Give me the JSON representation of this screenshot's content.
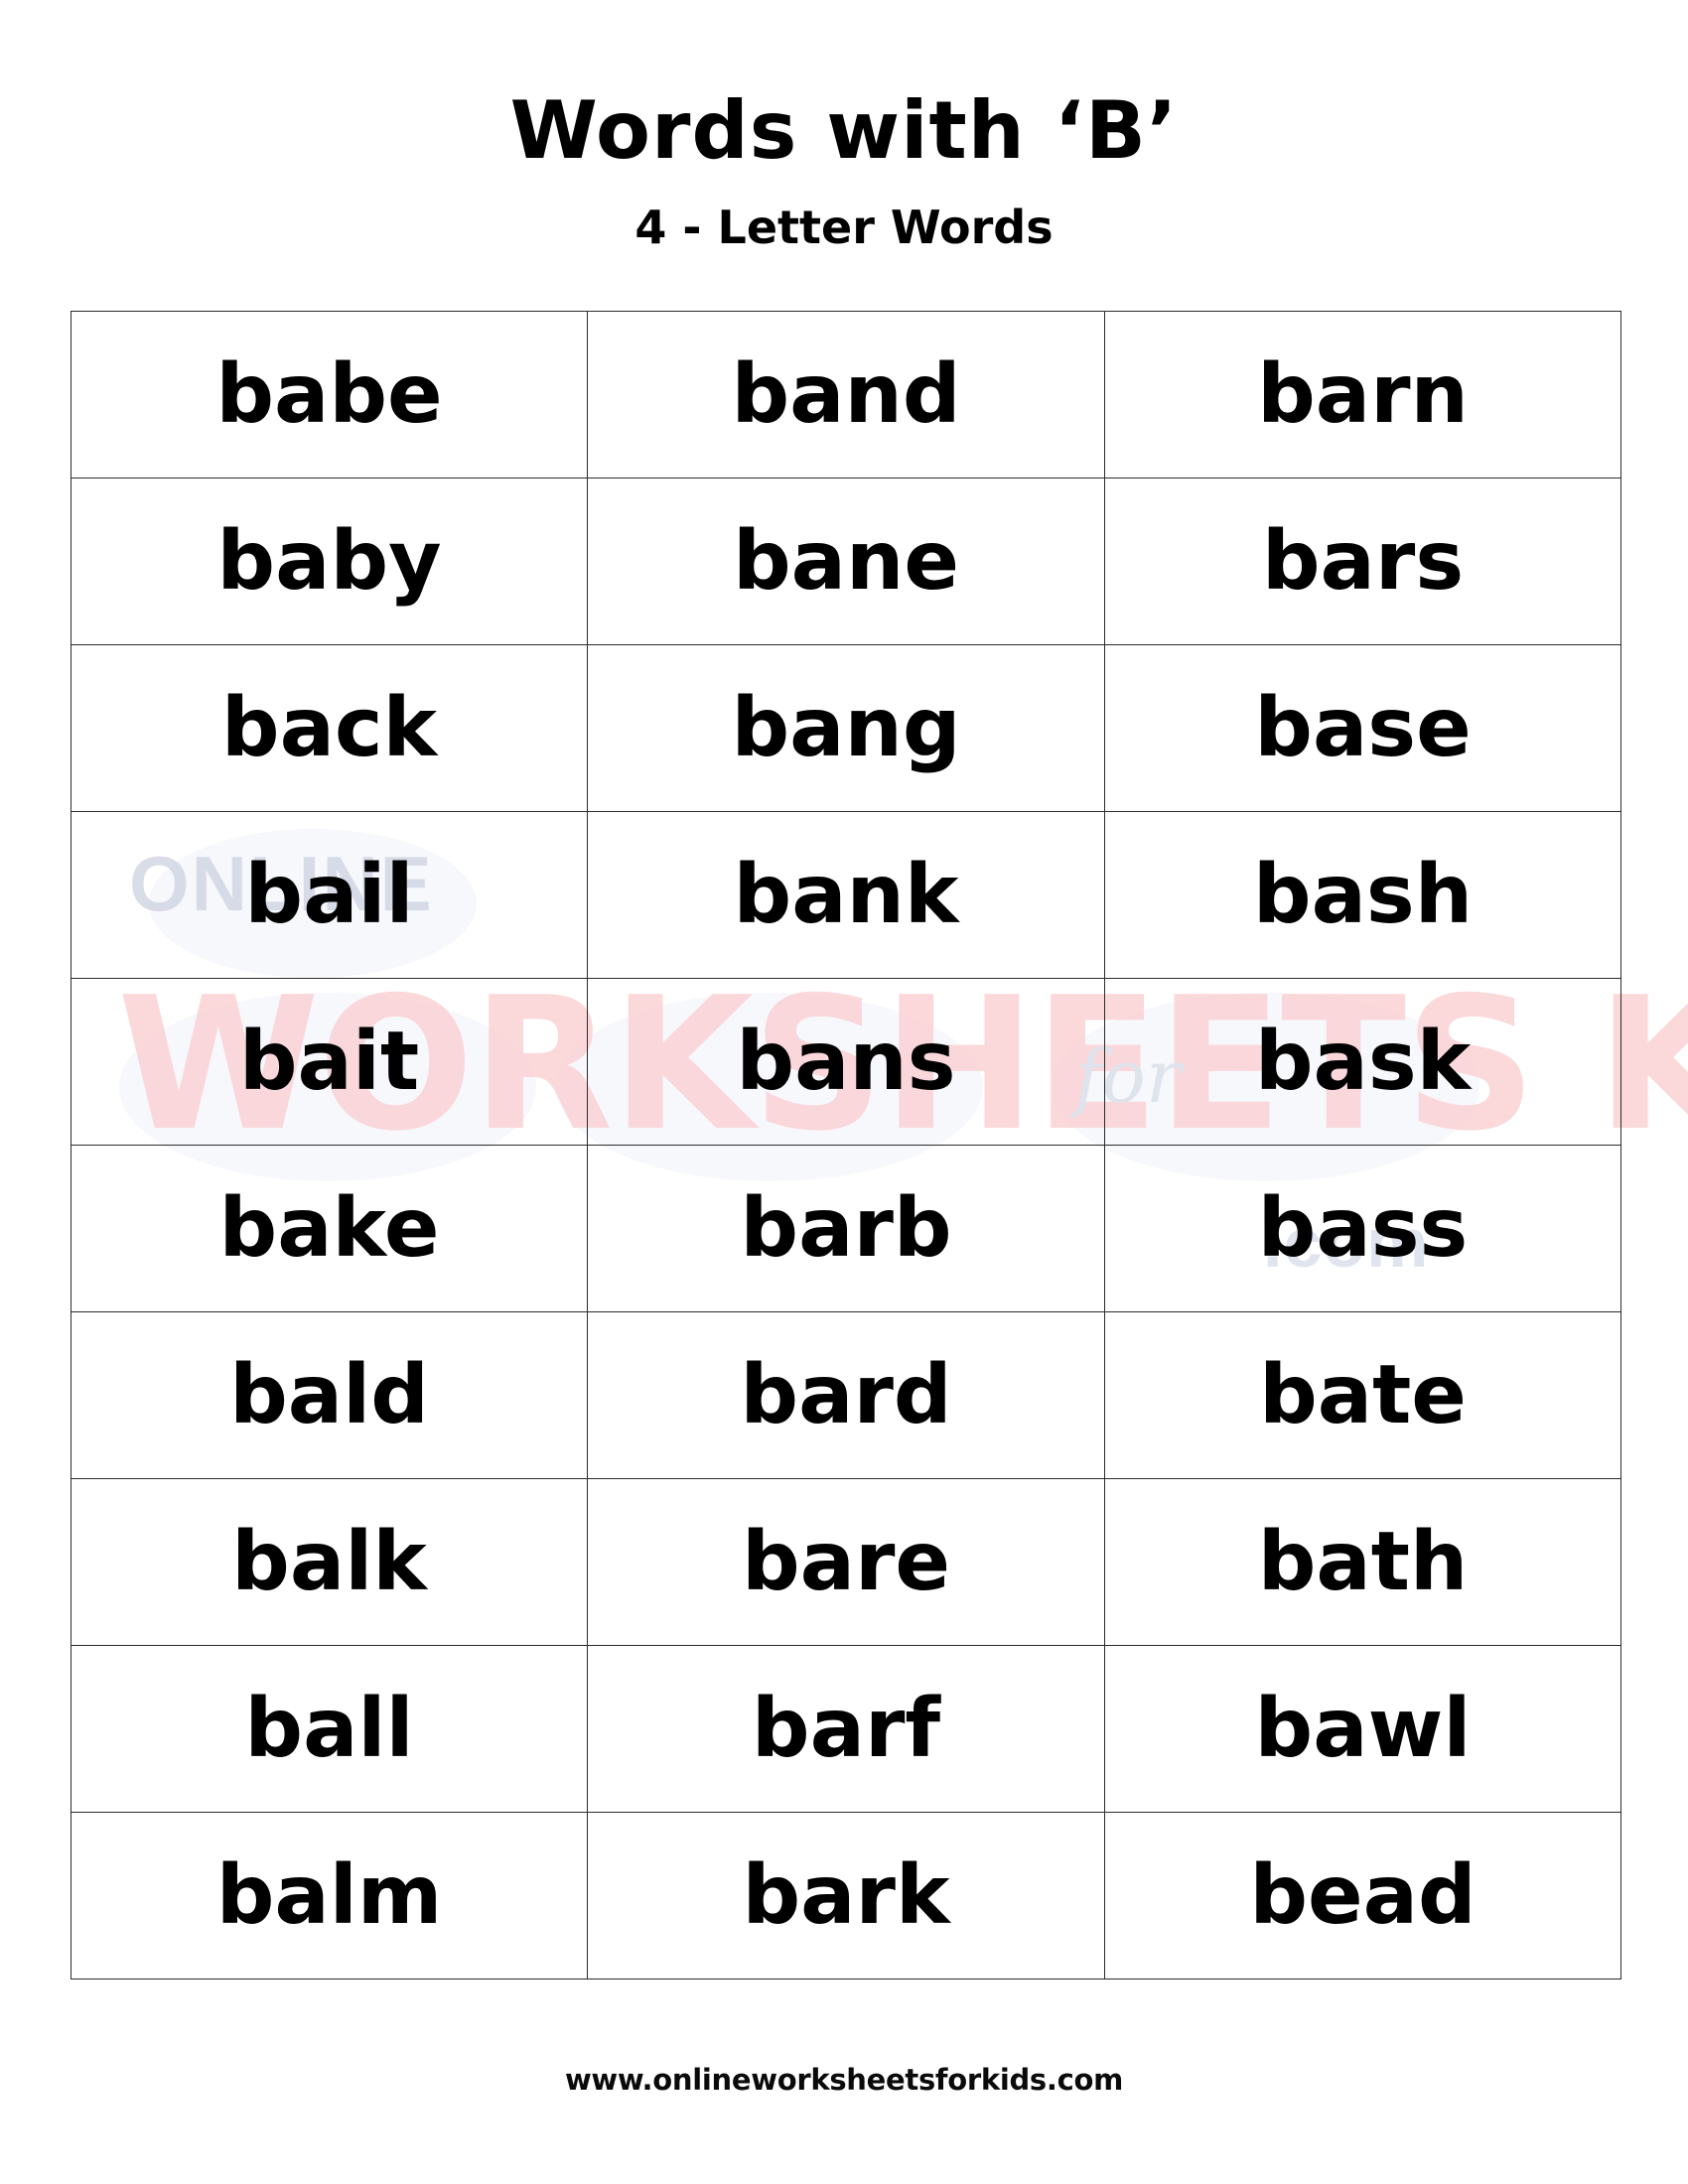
{
  "page": {
    "title": "Words with ‘B’",
    "subtitle": "4 - Letter Words",
    "background_color": "#ffffff",
    "text_color": "#000000",
    "border_color": "#2b2b2b"
  },
  "watermark": {
    "online_text": "ONLINE",
    "main_text": "WORKSHEETS KIDS",
    "for_text": "for",
    "com_text": ".com",
    "pink_color": "#fbd6d9",
    "gray_color": "#dde2ed"
  },
  "table": {
    "columns": 3,
    "rows": 10,
    "cells": [
      [
        "babe",
        "band",
        "barn"
      ],
      [
        "baby",
        "bane",
        "bars"
      ],
      [
        "back",
        "bang",
        "base"
      ],
      [
        "bail",
        "bank",
        "bash"
      ],
      [
        "bait",
        "bans",
        "bask"
      ],
      [
        "bake",
        "barb",
        "bass"
      ],
      [
        "bald",
        "bard",
        "bate"
      ],
      [
        "balk",
        "bare",
        "bath"
      ],
      [
        "ball",
        "barf",
        "bawl"
      ],
      [
        "balm",
        "bark",
        "bead"
      ]
    ]
  },
  "footer": {
    "url": "www.onlineworksheetsforkids.com"
  }
}
